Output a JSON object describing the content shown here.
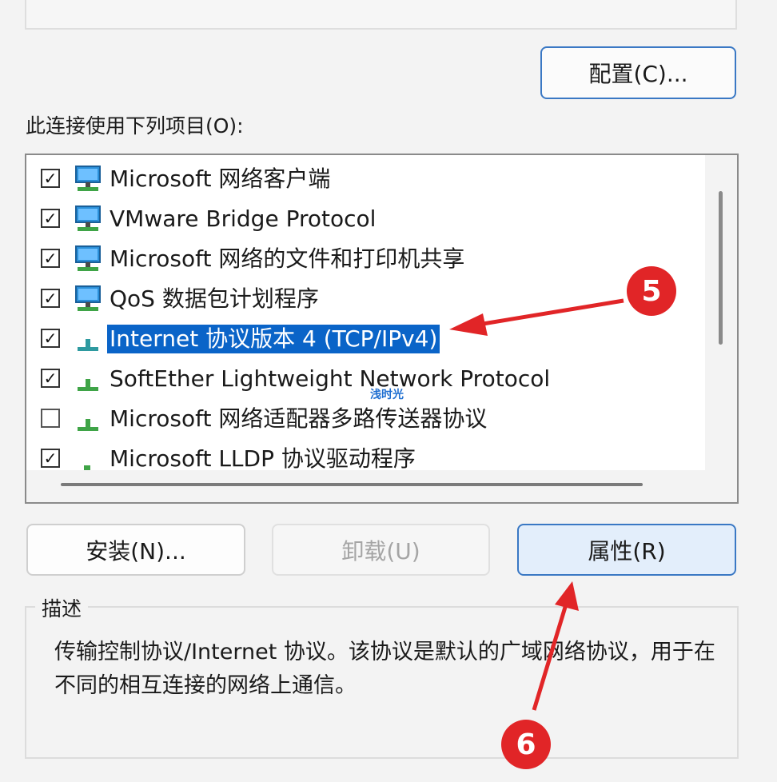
{
  "buttons": {
    "configure": "配置(C)...",
    "install": "安装(N)...",
    "uninstall": "卸载(U)",
    "properties": "属性(R)"
  },
  "list": {
    "label": "此连接使用下列项目(O):",
    "items": [
      {
        "label": "Microsoft 网络客户端",
        "checked": true,
        "icon": "network-client-icon"
      },
      {
        "label": "VMware Bridge Protocol",
        "checked": true,
        "icon": "network-service-icon"
      },
      {
        "label": "Microsoft 网络的文件和打印机共享",
        "checked": true,
        "icon": "network-service-icon"
      },
      {
        "label": "QoS 数据包计划程序",
        "checked": true,
        "icon": "network-service-icon"
      },
      {
        "label": "Internet 协议版本 4 (TCP/IPv4)",
        "checked": true,
        "selected": true,
        "icon": "protocol-icon"
      },
      {
        "label": "SoftEther Lightweight Network Protocol",
        "checked": true,
        "icon": "protocol-icon"
      },
      {
        "label": "Microsoft 网络适配器多路传送器协议",
        "checked": false,
        "icon": "protocol-icon"
      },
      {
        "label": "Microsoft LLDP 协议驱动程序",
        "checked": true,
        "icon": "protocol-icon"
      }
    ]
  },
  "description": {
    "legend": "描述",
    "text": "传输控制协议/Internet 协议。该协议是默认的广域网络协议，用于在不同的相互连接的网络上通信。"
  },
  "annotations": {
    "step5": "5",
    "step6": "6",
    "watermark": "浅时光"
  },
  "colors": {
    "accent": "#0a64c8",
    "annotation": "#e12527"
  }
}
